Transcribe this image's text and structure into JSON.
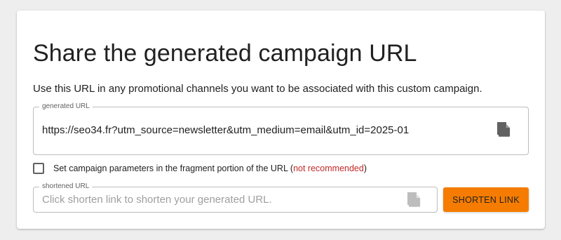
{
  "card": {
    "title": "Share the generated campaign URL",
    "description": "Use this URL in any promotional channels you want to be associated with this custom campaign."
  },
  "generated_url": {
    "legend": "generated URL",
    "value": "https://seo34.fr?utm_source=newsletter&utm_medium=email&utm_id=2025-01",
    "copy_icon": "copy-icon"
  },
  "fragment_option": {
    "checked": false,
    "label_prefix": "Set campaign parameters in the fragment portion of the URL (",
    "label_warning": "not recommended",
    "label_suffix": ")",
    "warning_color": "#c62828"
  },
  "shortened_url": {
    "legend": "shortened URL",
    "placeholder": "Click shorten link to shorten your generated URL.",
    "copy_icon": "copy-icon"
  },
  "shorten_button": {
    "label": "Shorten link",
    "color": "#f57c00"
  }
}
